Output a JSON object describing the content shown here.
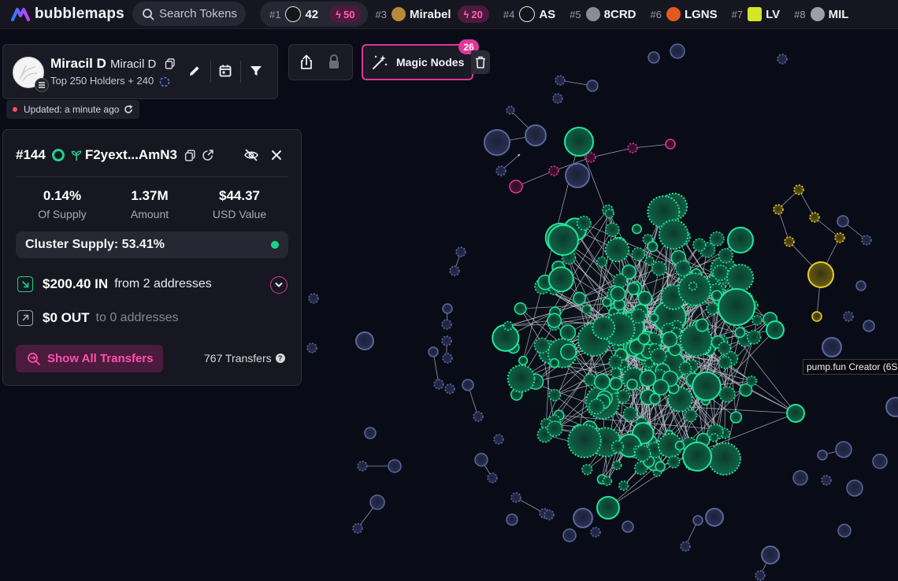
{
  "app": {
    "name": "bubblemaps",
    "search_placeholder": "Search Tokens"
  },
  "top_ranks": [
    {
      "rank": "#1",
      "name": "42",
      "boost": "50",
      "active": true,
      "color": "#dfe2e6"
    },
    {
      "rank": "#3",
      "name": "Mirabel",
      "boost": "20",
      "active": false,
      "color": "#b78a3a"
    },
    {
      "rank": "#4",
      "name": "AS",
      "boost": "",
      "active": false,
      "color": "#e6e6ea"
    },
    {
      "rank": "#5",
      "name": "8CRD",
      "boost": "",
      "active": false,
      "color": "#8a8b95"
    },
    {
      "rank": "#6",
      "name": "LGNS",
      "boost": "",
      "active": false,
      "color": "#e25a20"
    },
    {
      "rank": "#7",
      "name": "LV",
      "boost": "",
      "active": false,
      "color": "#d4e62a"
    },
    {
      "rank": "#8",
      "name": "MIL",
      "boost": "",
      "active": false,
      "color": "#9aa0a6"
    }
  ],
  "token": {
    "name": "Miracil D",
    "symbol": "Miracil D",
    "subtitle": "Top 250 Holders + 240",
    "updated": "Updated: a minute ago"
  },
  "magic_nodes": {
    "label": "Magic Nodes",
    "count": "26"
  },
  "wallet": {
    "rank": "#144",
    "address": "F2yext...AmN3",
    "stats": [
      {
        "value": "0.14%",
        "label": "Of Supply"
      },
      {
        "value": "1.37M",
        "label": "Amount"
      },
      {
        "value": "$44.37",
        "label": "USD Value"
      }
    ],
    "cluster_supply": "Cluster Supply: 53.41%",
    "inflow": {
      "amount": "$200.40 IN",
      "desc": "from 2 addresses"
    },
    "outflow": {
      "amount": "$0 OUT",
      "desc": "to 0 addresses"
    },
    "show_all_label": "Show All Transfers",
    "transfers_count": "767 Transfers"
  },
  "tooltip": "pump.fun Creator (6S",
  "colors": {
    "background": "#090b16",
    "accent_pink": "#e0369a",
    "cluster_green": "#19d38a",
    "creator_yellow": "#d9c21f",
    "isolated_blue": "#2a3154"
  }
}
